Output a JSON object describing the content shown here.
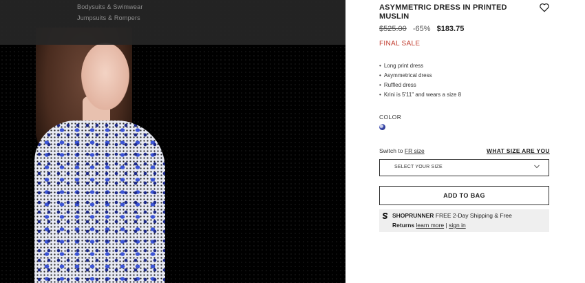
{
  "menu": {
    "items": [
      "Bodysuits & Swimwear",
      "Jumpsuits & Rompers"
    ]
  },
  "product": {
    "title": "ASYMMETRIC DRESS IN PRINTED MUSLIN",
    "original_price": "$525.00",
    "discount": "-65%",
    "sale_price": "$183.75",
    "final_sale": "FINAL SALE",
    "features": [
      "Long print dress",
      "Asymmetrical dress",
      "Ruffled dress",
      "Krini is 5'11\" and wears a size 8"
    ],
    "color_label": "COLOR",
    "swatch_icon": "print-swatch"
  },
  "size": {
    "switch_prefix": "Switch to",
    "switch_link": "FR size",
    "size_guide": "WHAT SIZE ARE YOU",
    "select_placeholder": "SELECT YOUR SIZE"
  },
  "actions": {
    "add_to_bag": "ADD TO BAG",
    "wishlist_icon": "heart-icon"
  },
  "shoprunner": {
    "brand": "SHOPRUNNER",
    "text": "FREE 2-Day Shipping & Free",
    "returns": "Returns",
    "learn_more": "learn more",
    "separator": "|",
    "sign_in": "sign in"
  },
  "colors": {
    "final_sale": "#c0392b",
    "overlay": "#262626"
  }
}
